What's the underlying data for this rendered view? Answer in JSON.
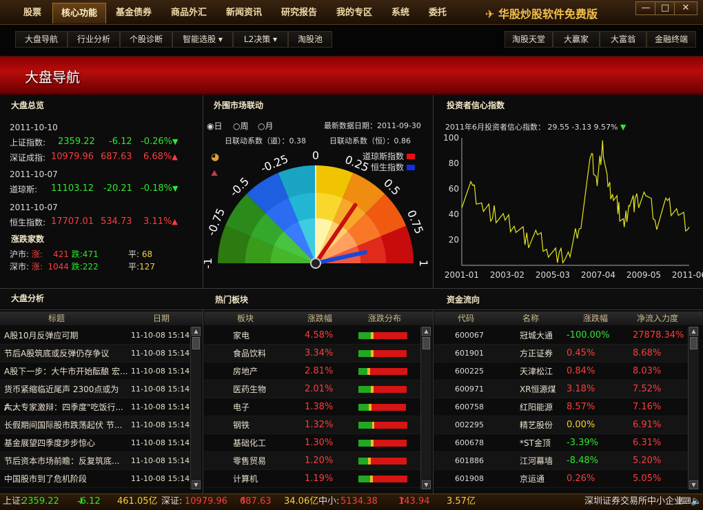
{
  "menu": {
    "tabs": [
      "股票",
      "核心功能",
      "基金债券",
      "商品外汇",
      "新闻资讯",
      "研究报告",
      "我的专区",
      "系统",
      "委托"
    ],
    "active_index": 1,
    "brand": "华股炒股软件免费版",
    "win_min": "—",
    "win_max": "□",
    "win_close": "✕"
  },
  "subnav": {
    "left": [
      "大盘导航",
      "行业分析",
      "个股诊断",
      "智能选股 ▾",
      "L2决策 ▾",
      "淘股池"
    ],
    "right": [
      "淘股天堂",
      "大赢家",
      "大富翁",
      "金融终端"
    ]
  },
  "banner": {
    "title": "大盘导航"
  },
  "overview": {
    "title": "大盘总览",
    "date1": "2011-10-10",
    "sh": {
      "label": "上证指数:",
      "value": "2359.22",
      "chg": "-6.12",
      "pct": "-0.26%"
    },
    "sz": {
      "label": "深证成指:",
      "value": "10979.96",
      "chg": "687.63",
      "pct": "6.68%"
    },
    "date2": "2011-10-07",
    "dj": {
      "label": "道琼斯:",
      "value": "11103.12",
      "chg": "-20.21",
      "pct": "-0.18%"
    },
    "date3": "2011-10-07",
    "hs": {
      "label": "恒生指数:",
      "value": "17707.01",
      "chg": "534.73",
      "pct": "3.11%"
    },
    "updown_title": "涨跌家数",
    "hu": {
      "label": "沪市:",
      "up_label": "涨:",
      "up": "421",
      "down_label": "跌:",
      "down": "471",
      "flat_label": "平:",
      "flat": "68"
    },
    "shen": {
      "label": "深市:",
      "up_label": "涨:",
      "up": "1044",
      "down_label": "跌:",
      "down": "222",
      "flat_label": "平:",
      "flat": "127"
    }
  },
  "foreign": {
    "title": "外围市场联动",
    "periods": [
      "日",
      "周",
      "月"
    ],
    "selected_period": 0,
    "latest": "最新数据日期：2011-09-30",
    "coef_dj": "日联动系数（道）：0.38",
    "coef_hs": "日联动系数（恒）：0.86",
    "legend": [
      {
        "name": "道琼斯指数",
        "color": "#e81010"
      },
      {
        "name": "恒生指数",
        "color": "#1030e8"
      }
    ],
    "gauge_labels": [
      "-1",
      "-0.75",
      "-0.5",
      "-0.25",
      "0",
      "0.25",
      "0.5",
      "0.75",
      "1"
    ],
    "needle_dj": 0.38,
    "needle_hs": 0.86
  },
  "confidence": {
    "title": "投资者信心指数",
    "summary": "2011年6月投资者信心指数：",
    "value": "29.55",
    "chg": "-3.13",
    "pct": "9.57%"
  },
  "chart_data": {
    "type": "line",
    "title": "投资者信心指数",
    "ylim": [
      0,
      100
    ],
    "yticks": [
      "20",
      "40",
      "60",
      "80",
      "100"
    ],
    "xticks": [
      "2001-01",
      "2003-02",
      "2005-03",
      "2007-04",
      "2009-05",
      "2011-06"
    ],
    "x": [
      2001.0,
      2001.5,
      2002.0,
      2002.5,
      2003.0,
      2003.5,
      2004.0,
      2004.5,
      2005.0,
      2005.5,
      2006.0,
      2006.5,
      2007.0,
      2007.25,
      2007.5,
      2007.75,
      2008.0,
      2008.25,
      2008.5,
      2008.75,
      2009.0,
      2009.5,
      2010.0,
      2010.5,
      2011.0,
      2011.5
    ],
    "series": [
      {
        "color": "#e6e61e",
        "values": [
          52,
          60,
          45,
          40,
          34,
          30,
          20,
          24,
          12,
          6,
          8,
          36,
          85,
          65,
          96,
          60,
          55,
          44,
          30,
          52,
          48,
          56,
          35,
          48,
          42,
          30
        ]
      }
    ]
  },
  "analysis": {
    "title": "大盘分析",
    "headers": [
      "标题",
      "日期"
    ],
    "rows": [
      {
        "title": "A股10月反弹应可期",
        "date": "11-10-08 15:14"
      },
      {
        "title": "节后A股筑底或反弹仍存争议",
        "date": "11-10-08 15:14"
      },
      {
        "title": "A股下一步：大牛市开始酝酿 宏...",
        "date": "11-10-08 15:14"
      },
      {
        "title": "货币紧缩临近尾声 2300点或为A...",
        "date": "11-10-08 15:14"
      },
      {
        "title": "六大专家激辩：四季度\"吃饭行...",
        "date": "11-10-08 15:14"
      },
      {
        "title": "长假期间国际股市跌荡起伏 节...",
        "date": "11-10-08 15:14"
      },
      {
        "title": "基金展望四季度步步惊心",
        "date": "11-10-08 15:14"
      },
      {
        "title": "节后资本市场前瞻：反复筑底...",
        "date": "11-10-08 15:14"
      },
      {
        "title": "中国股市到了危机阶段",
        "date": "11-10-08 15:14"
      }
    ]
  },
  "hot": {
    "title": "热门板块",
    "headers": [
      "板块",
      "涨跌幅",
      "涨跌分布"
    ],
    "rows": [
      {
        "name": "家电",
        "pct": "4.58%",
        "dist": [
          0.25,
          0.05,
          0.7
        ]
      },
      {
        "name": "食品饮料",
        "pct": "3.34%",
        "dist": [
          0.25,
          0.06,
          0.69
        ]
      },
      {
        "name": "房地产",
        "pct": "2.81%",
        "dist": [
          0.18,
          0.05,
          0.77
        ]
      },
      {
        "name": "医药生物",
        "pct": "2.01%",
        "dist": [
          0.26,
          0.05,
          0.69
        ]
      },
      {
        "name": "电子",
        "pct": "1.38%",
        "dist": [
          0.22,
          0.06,
          0.72
        ]
      },
      {
        "name": "钢铁",
        "pct": "1.32%",
        "dist": [
          0.28,
          0.04,
          0.68
        ]
      },
      {
        "name": "基础化工",
        "pct": "1.30%",
        "dist": [
          0.26,
          0.06,
          0.68
        ]
      },
      {
        "name": "零售贸易",
        "pct": "1.20%",
        "dist": [
          0.2,
          0.06,
          0.74
        ]
      },
      {
        "name": "计算机",
        "pct": "1.19%",
        "dist": [
          0.24,
          0.05,
          0.71
        ]
      }
    ]
  },
  "flow": {
    "title": "资金流向",
    "headers": [
      "代码",
      "名称",
      "涨跌幅",
      "净流入力度"
    ],
    "rows": [
      {
        "code": "600067",
        "name": "冠城大通",
        "pct": "-100.00%",
        "flow": "27878.34%",
        "pct_color": "g"
      },
      {
        "code": "601901",
        "name": "方正证券",
        "pct": "0.45%",
        "flow": "8.68%",
        "pct_color": "r"
      },
      {
        "code": "600225",
        "name": "天津松江",
        "pct": "0.84%",
        "flow": "8.03%",
        "pct_color": "r"
      },
      {
        "code": "600971",
        "name": "XR恒源煤",
        "pct": "3.18%",
        "flow": "7.52%",
        "pct_color": "r"
      },
      {
        "code": "600758",
        "name": "红阳能源",
        "pct": "8.57%",
        "flow": "7.16%",
        "pct_color": "r"
      },
      {
        "code": "002295",
        "name": "精艺股份",
        "pct": "0.00%",
        "flow": "6.91%",
        "pct_color": "y"
      },
      {
        "code": "600678",
        "name": "*ST金顶",
        "pct": "-3.39%",
        "flow": "6.31%",
        "pct_color": "g"
      },
      {
        "code": "601886",
        "name": "江河幕墙",
        "pct": "-8.48%",
        "flow": "5.20%",
        "pct_color": "g"
      },
      {
        "code": "601908",
        "name": "京运通",
        "pct": "0.26%",
        "flow": "5.05%",
        "pct_color": "r"
      }
    ]
  },
  "status": {
    "sh_label": "上证:",
    "sh_val": "2359.22",
    "sh_chg": "-6.12",
    "sh_amt": "461.05亿",
    "sz_label": "深证:",
    "sz_val": "10979.96",
    "sz_chg": "687.63",
    "sz_amt": "34.06亿",
    "zx_label": "中小:",
    "zx_val": "5134.38",
    "zx_chg": "143.94",
    "zx_amt": "3.57亿",
    "ticker": "深圳证券交易所中小企业"
  }
}
